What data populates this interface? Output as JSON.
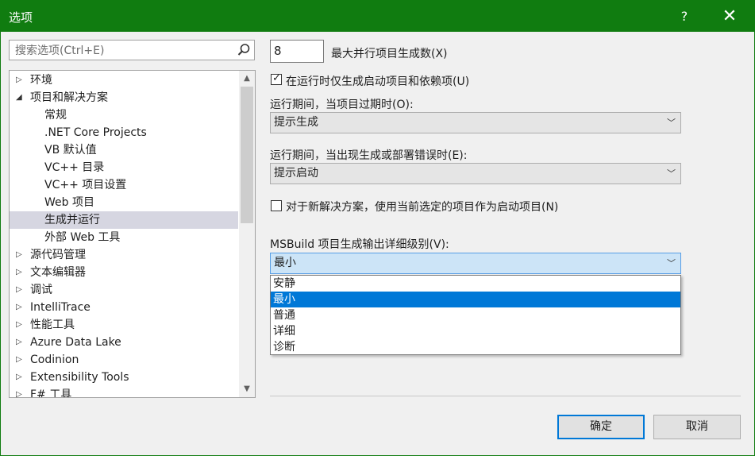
{
  "window": {
    "title": "选项",
    "help": "?",
    "close": "✕"
  },
  "search": {
    "placeholder": "搜索选项(Ctrl+E)"
  },
  "tree": {
    "items": [
      {
        "label": "环境",
        "arrow": "▷"
      },
      {
        "label": "项目和解决方案",
        "arrow": "◢"
      },
      {
        "label": "常规",
        "arrow": ""
      },
      {
        "label": ".NET Core Projects",
        "arrow": ""
      },
      {
        "label": "VB 默认值",
        "arrow": ""
      },
      {
        "label": "VC++ 目录",
        "arrow": ""
      },
      {
        "label": "VC++ 项目设置",
        "arrow": ""
      },
      {
        "label": "Web 项目",
        "arrow": ""
      },
      {
        "label": "生成并运行",
        "arrow": ""
      },
      {
        "label": "外部 Web 工具",
        "arrow": ""
      },
      {
        "label": "源代码管理",
        "arrow": "▷"
      },
      {
        "label": "文本编辑器",
        "arrow": "▷"
      },
      {
        "label": "调试",
        "arrow": "▷"
      },
      {
        "label": "IntelliTrace",
        "arrow": "▷"
      },
      {
        "label": "性能工具",
        "arrow": "▷"
      },
      {
        "label": "Azure Data Lake",
        "arrow": "▷"
      },
      {
        "label": "Codinion",
        "arrow": "▷"
      },
      {
        "label": "Extensibility Tools",
        "arrow": "▷"
      },
      {
        "label": "F# 工具",
        "arrow": "▷"
      }
    ],
    "selected_index": 8,
    "scroll_up": "▲",
    "scroll_down": "▼"
  },
  "settings": {
    "parallel_value": "8",
    "parallel_label": "最大并行项目生成数(X)",
    "only_startup_checked": "✓",
    "only_startup_label": "在运行时仅生成启动项目和依赖项(U)",
    "outdated_label": "运行期间，当项目过期时(O):",
    "outdated_value": "提示生成",
    "errors_label": "运行期间，当出现生成或部署错误时(E):",
    "errors_value": "提示启动",
    "new_solution_label": "对于新解决方案，使用当前选定的项目作为启动项目(N)",
    "msbuild_label": "MSBuild 项目生成输出详细级别(V):",
    "msbuild_value": "最小",
    "msbuild_options": [
      "安静",
      "最小",
      "普通",
      "详细",
      "诊断"
    ],
    "msbuild_hover_index": 1,
    "chevron": "﹀"
  },
  "buttons": {
    "ok": "确定",
    "cancel": "取消"
  },
  "colors": {
    "titlebar": "#107c10",
    "selection": "#0078d7"
  }
}
